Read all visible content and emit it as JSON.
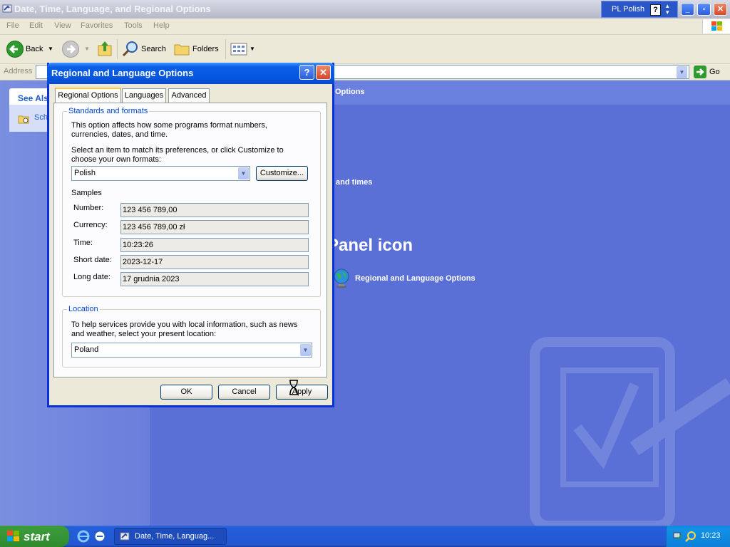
{
  "window": {
    "title": "Date, Time, Language, and Regional Options",
    "language_indicator": "PL  Polish",
    "help_glyph": "?",
    "controls": {
      "minimize": "_",
      "maximize": "▫",
      "close": "✕"
    }
  },
  "menu": [
    "File",
    "Edit",
    "View",
    "Favorites",
    "Tools",
    "Help"
  ],
  "toolbar": {
    "back": "Back",
    "search": "Search",
    "folders": "Folders"
  },
  "address": {
    "label": "Address",
    "go": "Go"
  },
  "left_pane": {
    "see_also_title": "See Als",
    "item": "Sch"
  },
  "content": {
    "header_fragment": "Options",
    "task_fragment": "and times",
    "section_heading_fragment": "Panel icon",
    "cp_icon_label": "Regional and Language Options"
  },
  "dialog": {
    "title": "Regional and Language Options",
    "help_label": "?",
    "close_label": "✕",
    "tabs": [
      "Regional Options",
      "Languages",
      "Advanced"
    ],
    "standards": {
      "group_label": "Standards and formats",
      "description": "This option affects how some programs format numbers, currencies, dates, and time.",
      "select_prompt": "Select an item to match its preferences, or click Customize to choose your own formats:",
      "selected_format": "Polish",
      "customize": "Customize...",
      "samples_label": "Samples",
      "samples": [
        {
          "label": "Number:",
          "value": "123 456 789,00"
        },
        {
          "label": "Currency:",
          "value": "123 456 789,00 zł"
        },
        {
          "label": "Time:",
          "value": "10:23:26"
        },
        {
          "label": "Short date:",
          "value": "2023-12-17"
        },
        {
          "label": "Long date:",
          "value": "17 grudnia 2023"
        }
      ]
    },
    "location": {
      "group_label": "Location",
      "description": "To help services provide you with local information, such as news and weather, select your present location:",
      "selected": "Poland"
    },
    "buttons": {
      "ok": "OK",
      "cancel": "Cancel",
      "apply": "Apply"
    }
  },
  "taskbar": {
    "start": "start",
    "task": "Date, Time, Languag...",
    "clock": "10:23"
  },
  "colors": {
    "desktop_blue": "#5a70d6",
    "title_blue": "#0457e0",
    "group_label_blue": "#0046d5",
    "start_green": "#3a9a3a"
  }
}
